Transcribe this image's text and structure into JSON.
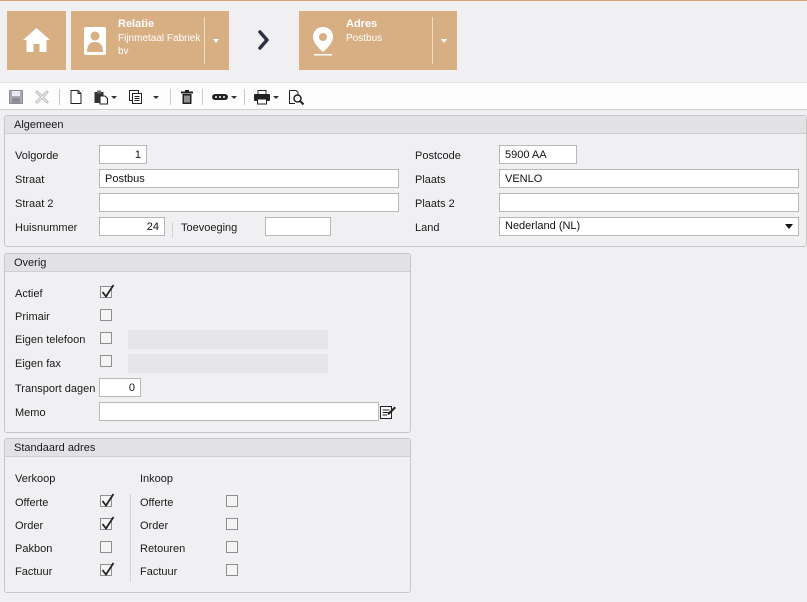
{
  "breadcrumb": {
    "home": {
      "icon": "home-icon"
    },
    "relatie": {
      "title": "Relatie",
      "subtitle": "Fijnmetaal Fabriek bv",
      "icon": "person-icon"
    },
    "adres": {
      "title": "Adres",
      "subtitle": "Postbus",
      "icon": "location-pin-icon"
    }
  },
  "toolbar": {
    "icons": [
      "save-icon",
      "cancel-icon",
      "new-document-icon",
      "paste-icon",
      "copy-icon",
      "delete-icon",
      "more-icon",
      "print-icon",
      "preview-icon"
    ]
  },
  "algemeen": {
    "title": "Algemeen",
    "volgorde": {
      "label": "Volgorde",
      "value": "1"
    },
    "straat": {
      "label": "Straat",
      "value": "Postbus"
    },
    "straat2": {
      "label": "Straat 2",
      "value": ""
    },
    "huisnummer": {
      "label": "Huisnummer",
      "value": "24"
    },
    "toevoeging": {
      "label": "Toevoeging",
      "value": ""
    },
    "postcode": {
      "label": "Postcode",
      "value": "5900 AA"
    },
    "plaats": {
      "label": "Plaats",
      "value": "VENLO"
    },
    "plaats2": {
      "label": "Plaats 2",
      "value": ""
    },
    "land": {
      "label": "Land",
      "value": "Nederland (NL)"
    }
  },
  "overig": {
    "title": "Overig",
    "actief": {
      "label": "Actief",
      "checked": true
    },
    "primair": {
      "label": "Primair",
      "checked": false
    },
    "eigen_telefoon": {
      "label": "Eigen telefoon",
      "checked": false
    },
    "eigen_fax": {
      "label": "Eigen fax",
      "checked": false
    },
    "transport_dagen": {
      "label": "Transport dagen",
      "value": "0"
    },
    "memo": {
      "label": "Memo",
      "value": ""
    }
  },
  "standaard": {
    "title": "Standaard adres",
    "verkoop": {
      "header": "Verkoop",
      "items": [
        {
          "label": "Offerte",
          "checked": true
        },
        {
          "label": "Order",
          "checked": true
        },
        {
          "label": "Pakbon",
          "checked": false
        },
        {
          "label": "Factuur",
          "checked": true
        }
      ]
    },
    "inkoop": {
      "header": "Inkoop",
      "items": [
        {
          "label": "Offerte",
          "checked": false
        },
        {
          "label": "Order",
          "checked": false
        },
        {
          "label": "Retouren",
          "checked": false
        },
        {
          "label": "Factuur",
          "checked": false
        }
      ]
    }
  },
  "colors": {
    "tile": "#d8ae83",
    "panel_header": "#e2e2e6",
    "background": "#f0f0f3"
  }
}
